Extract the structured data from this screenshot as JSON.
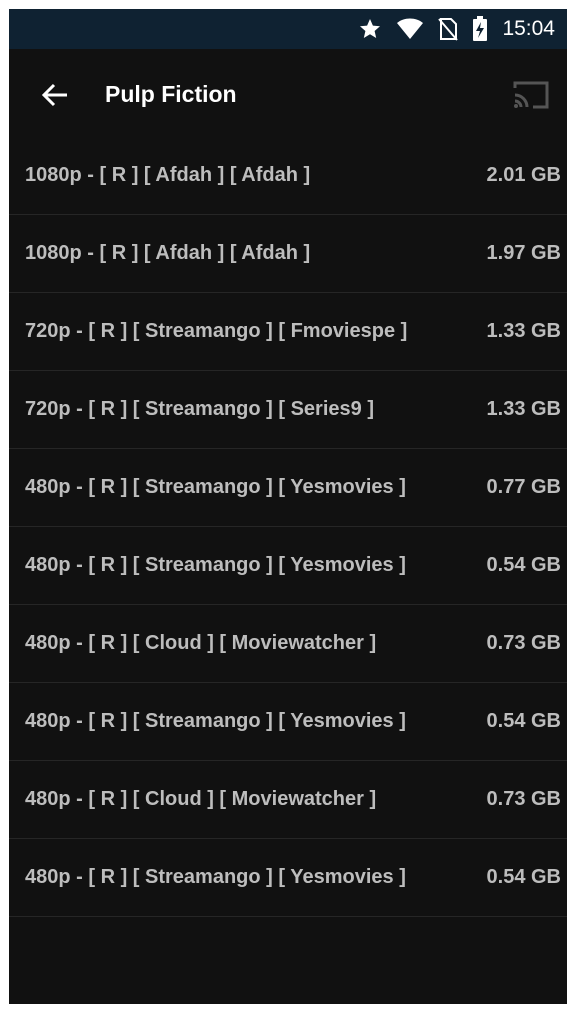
{
  "status_bar": {
    "time": "15:04",
    "icons": [
      "star-icon",
      "wifi-icon",
      "no-sim-icon",
      "battery-charging-icon"
    ]
  },
  "toolbar": {
    "title": "Pulp Fiction",
    "back_icon": "arrow-left-icon",
    "cast_icon": "cast-icon"
  },
  "sources": [
    {
      "label": "1080p -  [ R ] [ Afdah ]  [ Afdah ]",
      "size": "2.01 GB"
    },
    {
      "label": "1080p -  [ R ] [ Afdah ]  [ Afdah ]",
      "size": "1.97 GB"
    },
    {
      "label": "720p -  [ R ] [ Streamango ]  [ Fmoviespe ]",
      "size": "1.33 GB"
    },
    {
      "label": "720p -  [ R ] [ Streamango ]  [ Series9 ]",
      "size": "1.33 GB"
    },
    {
      "label": "480p -  [ R ] [ Streamango ]  [ Yesmovies ]",
      "size": "0.77 GB"
    },
    {
      "label": "480p -  [ R ] [ Streamango ]  [ Yesmovies ]",
      "size": "0.54 GB"
    },
    {
      "label": "480p -  [ R ] [ Cloud ]  [ Moviewatcher ]",
      "size": "0.73 GB"
    },
    {
      "label": "480p -  [ R ] [ Streamango ]  [ Yesmovies ]",
      "size": "0.54 GB"
    },
    {
      "label": "480p -  [ R ] [ Cloud ]  [ Moviewatcher ]",
      "size": "0.73 GB"
    },
    {
      "label": "480p -  [ R ] [ Streamango ]  [ Yesmovies ]",
      "size": "0.54 GB"
    }
  ],
  "colors": {
    "background": "#111111",
    "status_bar": "#0f2232",
    "text_primary": "#ffffff",
    "text_secondary": "#bdbdbd",
    "divider": "#262626",
    "cast_icon": "#555555"
  }
}
